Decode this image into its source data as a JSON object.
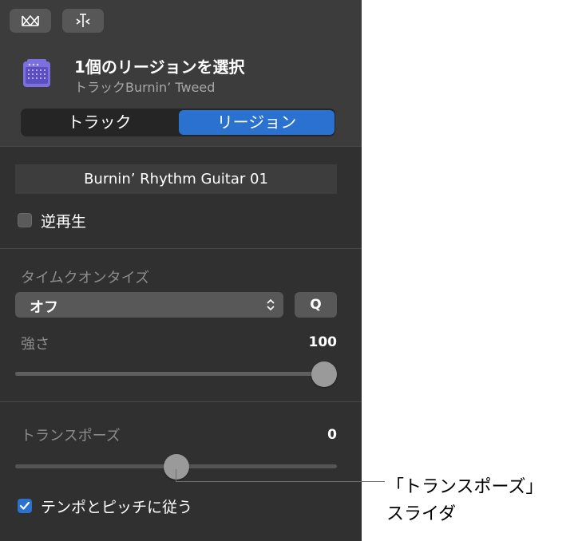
{
  "header": {
    "icons": {
      "left_button": "loop-browser-icon",
      "right_button": "smart-tempo-icon",
      "track": "guitar-amp-icon"
    },
    "title": "1個のリージョンを選択",
    "subtitle": "トラックBurnin’ Tweed",
    "tabs": [
      {
        "label": "トラック",
        "selected": false
      },
      {
        "label": "リージョン",
        "selected": true
      }
    ]
  },
  "region": {
    "name": "Burnin’ Rhythm Guitar 01",
    "reverse": {
      "label": "逆再生",
      "checked": false
    }
  },
  "quantize": {
    "label": "タイムクオンタイズ",
    "value": "オフ",
    "q_button": "Q",
    "strength": {
      "label": "強さ",
      "value": "100",
      "fraction": 1.0
    }
  },
  "transpose": {
    "label": "トランスポーズ",
    "value": "0",
    "fraction": 0.5,
    "follow_tempo": {
      "label": "テンポとピッチに従う",
      "checked": true
    }
  },
  "callout": {
    "line1": "「トランスポーズ」",
    "line2": "スライダ"
  },
  "colors": {
    "panel_bg": "#303030",
    "header_bg": "#3c3c3c",
    "accent": "#2a71d0",
    "control_bg": "#585858",
    "knob": "#9a9a9a"
  }
}
